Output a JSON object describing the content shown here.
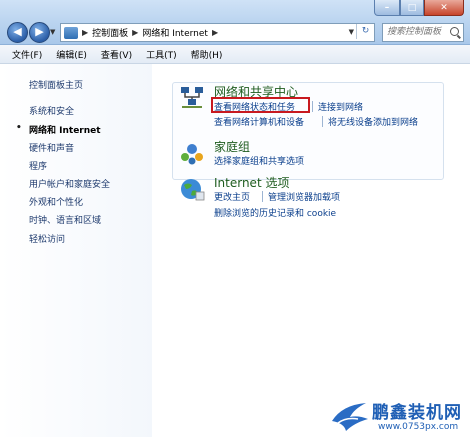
{
  "window": {
    "buttons": {
      "minimize": "–",
      "maximize": "□",
      "close": "✕"
    }
  },
  "nav": {
    "back": "◀",
    "forward": "▶",
    "dropdown": "▼"
  },
  "address": {
    "crumbs": [
      "控制面板",
      "网络和 Internet"
    ],
    "separator": "▶",
    "dropdown": "▼",
    "refresh": "↻"
  },
  "search": {
    "placeholder": "搜索控制面板"
  },
  "menu": [
    "文件(F)",
    "编辑(E)",
    "查看(V)",
    "工具(T)",
    "帮助(H)"
  ],
  "left_pane": {
    "items": [
      "控制面板主页",
      "系统和安全",
      "网络和 Internet",
      "硬件和声音",
      "程序",
      "用户帐户和家庭安全",
      "外观和个性化",
      "时钟、语言和区域",
      "轻松访问"
    ],
    "active_index": 2,
    "bullet": "•"
  },
  "categories": [
    {
      "title": "网络和共享中心",
      "links": [
        "查看网络状态和任务",
        "连接到网络",
        "查看网络计算机和设备",
        "将无线设备添加到网络"
      ]
    },
    {
      "title": "家庭组",
      "links": [
        "选择家庭组和共享选项"
      ]
    },
    {
      "title": "Internet 选项",
      "links": [
        "更改主页",
        "管理浏览器加载项",
        "删除浏览的历史记录和 cookie"
      ]
    }
  ],
  "watermark": {
    "title": "鹏鑫装机网",
    "url": "www.0753px.com"
  },
  "colors": {
    "title_green": "#1e5c1e",
    "link_blue": "#0b3f8c",
    "highlight_red": "#c8191f",
    "watermark_blue": "#1f5fb5"
  }
}
